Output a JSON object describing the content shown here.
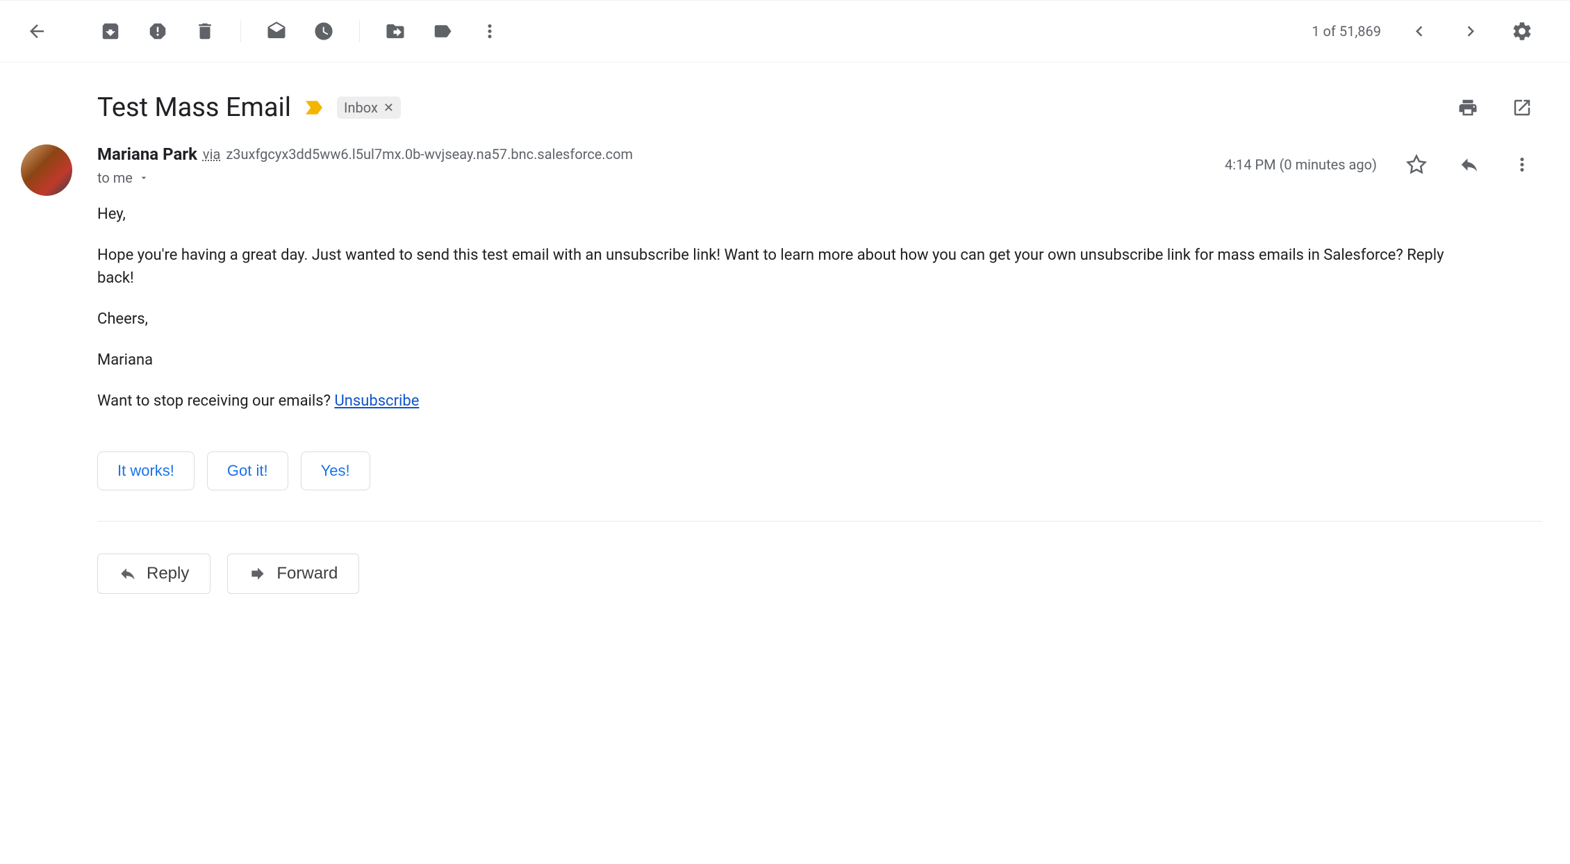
{
  "toolbar": {
    "pagination": "1 of 51,869"
  },
  "subject": {
    "text": "Test Mass Email",
    "label": "Inbox"
  },
  "sender": {
    "name": "Mariana Park",
    "via": "via",
    "via_domain": "z3uxfgcyx3dd5ww6.l5ul7mx.0b-wvjseay.na57.bnc.salesforce.com",
    "to": "to me",
    "timestamp": "4:14 PM (0 minutes ago)"
  },
  "body": {
    "greeting": "Hey,",
    "p1": "Hope you're having a great day. Just wanted to send this test email with an unsubscribe link! Want to learn more about how you can get your own unsubscribe link for mass emails in Salesforce? Reply back!",
    "closing": "Cheers,",
    "signature": "Mariana",
    "unsubscribe_prefix": "Want to stop receiving our emails? ",
    "unsubscribe_link": "Unsubscribe"
  },
  "smart_replies": [
    "It works!",
    "Got it!",
    "Yes!"
  ],
  "actions": {
    "reply": "Reply",
    "forward": "Forward"
  }
}
